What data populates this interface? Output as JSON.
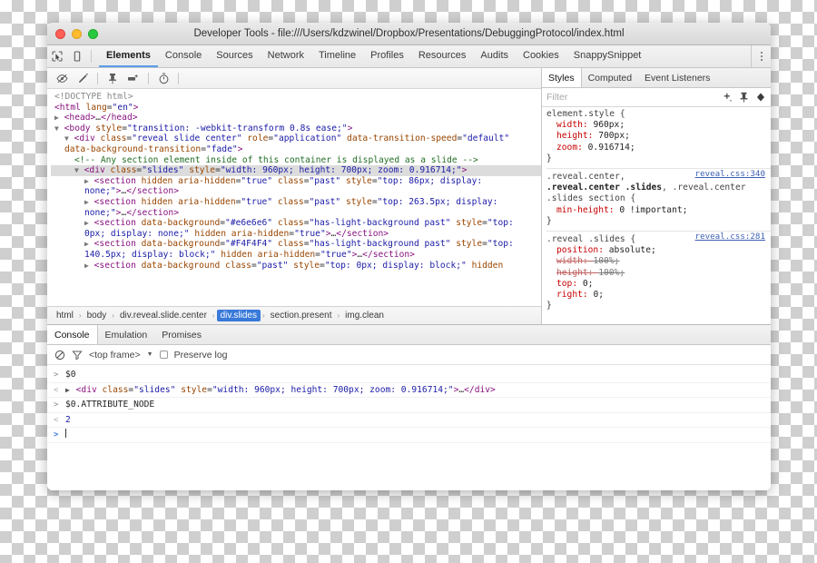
{
  "window": {
    "title": "Developer Tools - file:///Users/kdzwinel/Dropbox/Presentations/DebuggingProtocol/index.html",
    "traffic_lights": [
      "close-red",
      "minimize-yellow",
      "zoom-green"
    ]
  },
  "main_tabs": {
    "inspect_icon": "inspect-element-icon",
    "device_icon": "device-toolbar-icon",
    "menu_icon": "more-options-icon",
    "items": [
      {
        "label": "Elements",
        "active": true
      },
      {
        "label": "Console",
        "active": false
      },
      {
        "label": "Sources",
        "active": false
      },
      {
        "label": "Network",
        "active": false
      },
      {
        "label": "Timeline",
        "active": false
      },
      {
        "label": "Profiles",
        "active": false
      },
      {
        "label": "Resources",
        "active": false
      },
      {
        "label": "Audits",
        "active": false
      },
      {
        "label": "Cookies",
        "active": false
      },
      {
        "label": "SnappySnippet",
        "active": false
      }
    ]
  },
  "elements_toolbar": {
    "icons": [
      "hide-element-icon",
      "edit-as-html-icon",
      "pin-icon",
      "new-style-rule-icon",
      "animation-timer-icon"
    ]
  },
  "dom_tree": {
    "lines": [
      {
        "indent": 0,
        "twisty": "",
        "parts": [
          {
            "c": "dt",
            "t": "<!DOCTYPE html>"
          }
        ]
      },
      {
        "indent": 0,
        "twisty": "",
        "parts": [
          {
            "c": "tag",
            "t": "<html "
          },
          {
            "c": "attr",
            "t": "lang"
          },
          {
            "c": "txt",
            "t": "="
          },
          {
            "c": "val",
            "t": "\"en\""
          },
          {
            "c": "tag",
            "t": ">"
          }
        ]
      },
      {
        "indent": 0,
        "twisty": "right",
        "parts": [
          {
            "c": "tag",
            "t": "<head>"
          },
          {
            "c": "txt",
            "t": "…"
          },
          {
            "c": "tag",
            "t": "</head>"
          }
        ]
      },
      {
        "indent": 0,
        "twisty": "down",
        "parts": [
          {
            "c": "tag",
            "t": "<body "
          },
          {
            "c": "attr",
            "t": "style"
          },
          {
            "c": "txt",
            "t": "="
          },
          {
            "c": "val",
            "t": "\"transition: -webkit-transform 0.8s ease;\""
          },
          {
            "c": "tag",
            "t": ">"
          }
        ]
      },
      {
        "indent": 1,
        "twisty": "down",
        "parts": [
          {
            "c": "tag",
            "t": "<div "
          },
          {
            "c": "attr",
            "t": "class"
          },
          {
            "c": "txt",
            "t": "="
          },
          {
            "c": "val",
            "t": "\"reveal slide center\""
          },
          {
            "c": "txt",
            "t": " "
          },
          {
            "c": "attr",
            "t": "role"
          },
          {
            "c": "txt",
            "t": "="
          },
          {
            "c": "val",
            "t": "\"application\""
          },
          {
            "c": "txt",
            "t": " "
          },
          {
            "c": "attr",
            "t": "data-transition-speed"
          },
          {
            "c": "txt",
            "t": "="
          },
          {
            "c": "val",
            "t": "\"default\""
          }
        ]
      },
      {
        "indent": 1,
        "twisty": "",
        "parts": [
          {
            "c": "attr",
            "t": "data-background-transition"
          },
          {
            "c": "txt",
            "t": "="
          },
          {
            "c": "val",
            "t": "\"fade\""
          },
          {
            "c": "tag",
            "t": ">"
          }
        ]
      },
      {
        "indent": 2,
        "twisty": "",
        "parts": [
          {
            "c": "cmt",
            "t": "<!-- Any section element inside of this container is displayed as a slide -->"
          }
        ]
      },
      {
        "indent": 2,
        "twisty": "down",
        "selected": true,
        "parts": [
          {
            "c": "tag",
            "t": "<div "
          },
          {
            "c": "attr",
            "t": "class"
          },
          {
            "c": "txt",
            "t": "="
          },
          {
            "c": "val",
            "t": "\"slides\""
          },
          {
            "c": "txt",
            "t": " "
          },
          {
            "c": "attr",
            "t": "style"
          },
          {
            "c": "txt",
            "t": "="
          },
          {
            "c": "val",
            "t": "\"width: 960px; height: 700px; zoom: 0.916714;\""
          },
          {
            "c": "tag",
            "t": ">"
          }
        ]
      },
      {
        "indent": 3,
        "twisty": "right",
        "parts": [
          {
            "c": "tag",
            "t": "<section "
          },
          {
            "c": "attr",
            "t": "hidden"
          },
          {
            "c": "txt",
            "t": " "
          },
          {
            "c": "attr",
            "t": "aria-hidden"
          },
          {
            "c": "txt",
            "t": "="
          },
          {
            "c": "val",
            "t": "\"true\""
          },
          {
            "c": "txt",
            "t": " "
          },
          {
            "c": "attr",
            "t": "class"
          },
          {
            "c": "txt",
            "t": "="
          },
          {
            "c": "val",
            "t": "\"past\""
          },
          {
            "c": "txt",
            "t": " "
          },
          {
            "c": "attr",
            "t": "style"
          },
          {
            "c": "txt",
            "t": "="
          },
          {
            "c": "val",
            "t": "\"top: 86px; display:"
          }
        ]
      },
      {
        "indent": 3,
        "twisty": "",
        "parts": [
          {
            "c": "val",
            "t": "none;\""
          },
          {
            "c": "tag",
            "t": ">"
          },
          {
            "c": "txt",
            "t": "…"
          },
          {
            "c": "tag",
            "t": "</section>"
          }
        ]
      },
      {
        "indent": 3,
        "twisty": "right",
        "parts": [
          {
            "c": "tag",
            "t": "<section "
          },
          {
            "c": "attr",
            "t": "hidden"
          },
          {
            "c": "txt",
            "t": " "
          },
          {
            "c": "attr",
            "t": "aria-hidden"
          },
          {
            "c": "txt",
            "t": "="
          },
          {
            "c": "val",
            "t": "\"true\""
          },
          {
            "c": "txt",
            "t": " "
          },
          {
            "c": "attr",
            "t": "class"
          },
          {
            "c": "txt",
            "t": "="
          },
          {
            "c": "val",
            "t": "\"past\""
          },
          {
            "c": "txt",
            "t": " "
          },
          {
            "c": "attr",
            "t": "style"
          },
          {
            "c": "txt",
            "t": "="
          },
          {
            "c": "val",
            "t": "\"top: 263.5px; display:"
          }
        ]
      },
      {
        "indent": 3,
        "twisty": "",
        "parts": [
          {
            "c": "val",
            "t": "none;\""
          },
          {
            "c": "tag",
            "t": ">"
          },
          {
            "c": "txt",
            "t": "…"
          },
          {
            "c": "tag",
            "t": "</section>"
          }
        ]
      },
      {
        "indent": 3,
        "twisty": "right",
        "parts": [
          {
            "c": "tag",
            "t": "<section "
          },
          {
            "c": "attr",
            "t": "data-background"
          },
          {
            "c": "txt",
            "t": "="
          },
          {
            "c": "val",
            "t": "\"#e6e6e6\""
          },
          {
            "c": "txt",
            "t": " "
          },
          {
            "c": "attr",
            "t": "class"
          },
          {
            "c": "txt",
            "t": "="
          },
          {
            "c": "val",
            "t": "\"has-light-background past\""
          },
          {
            "c": "txt",
            "t": " "
          },
          {
            "c": "attr",
            "t": "style"
          },
          {
            "c": "txt",
            "t": "="
          },
          {
            "c": "val",
            "t": "\"top:"
          }
        ]
      },
      {
        "indent": 3,
        "twisty": "",
        "parts": [
          {
            "c": "val",
            "t": "0px; display: none;\""
          },
          {
            "c": "txt",
            "t": " "
          },
          {
            "c": "attr",
            "t": "hidden"
          },
          {
            "c": "txt",
            "t": " "
          },
          {
            "c": "attr",
            "t": "aria-hidden"
          },
          {
            "c": "txt",
            "t": "="
          },
          {
            "c": "val",
            "t": "\"true\""
          },
          {
            "c": "tag",
            "t": ">"
          },
          {
            "c": "txt",
            "t": "…"
          },
          {
            "c": "tag",
            "t": "</section>"
          }
        ]
      },
      {
        "indent": 3,
        "twisty": "right",
        "parts": [
          {
            "c": "tag",
            "t": "<section "
          },
          {
            "c": "attr",
            "t": "data-background"
          },
          {
            "c": "txt",
            "t": "="
          },
          {
            "c": "val",
            "t": "\"#F4F4F4\""
          },
          {
            "c": "txt",
            "t": " "
          },
          {
            "c": "attr",
            "t": "class"
          },
          {
            "c": "txt",
            "t": "="
          },
          {
            "c": "val",
            "t": "\"has-light-background past\""
          },
          {
            "c": "txt",
            "t": " "
          },
          {
            "c": "attr",
            "t": "style"
          },
          {
            "c": "txt",
            "t": "="
          },
          {
            "c": "val",
            "t": "\"top:"
          }
        ]
      },
      {
        "indent": 3,
        "twisty": "",
        "parts": [
          {
            "c": "val",
            "t": "140.5px; display: block;\""
          },
          {
            "c": "txt",
            "t": " "
          },
          {
            "c": "attr",
            "t": "hidden"
          },
          {
            "c": "txt",
            "t": " "
          },
          {
            "c": "attr",
            "t": "aria-hidden"
          },
          {
            "c": "txt",
            "t": "="
          },
          {
            "c": "val",
            "t": "\"true\""
          },
          {
            "c": "tag",
            "t": ">"
          },
          {
            "c": "txt",
            "t": "…"
          },
          {
            "c": "tag",
            "t": "</section>"
          }
        ]
      },
      {
        "indent": 3,
        "twisty": "right",
        "parts": [
          {
            "c": "tag",
            "t": "<section "
          },
          {
            "c": "attr",
            "t": "data-background"
          },
          {
            "c": "txt",
            "t": " "
          },
          {
            "c": "attr",
            "t": "class"
          },
          {
            "c": "txt",
            "t": "="
          },
          {
            "c": "val",
            "t": "\"past\""
          },
          {
            "c": "txt",
            "t": " "
          },
          {
            "c": "attr",
            "t": "style"
          },
          {
            "c": "txt",
            "t": "="
          },
          {
            "c": "val",
            "t": "\"top: 0px; display: block;\""
          },
          {
            "c": "txt",
            "t": " "
          },
          {
            "c": "attr",
            "t": "hidden"
          }
        ]
      }
    ]
  },
  "breadcrumb": {
    "items": [
      {
        "label": "html",
        "active": false
      },
      {
        "label": "body",
        "active": false
      },
      {
        "label": "div.reveal.slide.center",
        "active": false
      },
      {
        "label": "div.slides",
        "active": true
      },
      {
        "label": "section.present",
        "active": false
      },
      {
        "label": "img.clean",
        "active": false
      }
    ],
    "separator": "›"
  },
  "styles_panel": {
    "tabs": [
      {
        "label": "Styles",
        "active": true
      },
      {
        "label": "Computed",
        "active": false
      },
      {
        "label": "Event Listeners",
        "active": false
      }
    ],
    "filter_placeholder": "Filter",
    "toolbar_icons": [
      "new-style-rule-icon",
      "pin-icon",
      "toggle-element-state-icon"
    ],
    "rules": [
      {
        "selector_plain": "element.style {",
        "source": "",
        "declarations": [
          {
            "prop": "width",
            "value": "960px;",
            "overridden": false
          },
          {
            "prop": "height",
            "value": "700px;",
            "overridden": false
          },
          {
            "prop": "zoom",
            "value": "0.916714;",
            "overridden": false
          }
        ]
      },
      {
        "selector_line1": ".reveal.center,",
        "selector_line2_bold": ".reveal.center .slides",
        "selector_line2_rest": ", .reveal.center",
        "selector_line3": ".slides section {",
        "source": "reveal.css:340",
        "declarations": [
          {
            "prop": "min-height",
            "value": "0 !important;",
            "overridden": false
          }
        ]
      },
      {
        "selector_plain": ".reveal .slides {",
        "source": "reveal.css:281",
        "declarations": [
          {
            "prop": "position",
            "value": "absolute;",
            "overridden": false
          },
          {
            "prop": "width",
            "value": "100%;",
            "overridden": true
          },
          {
            "prop": "height",
            "value": "100%;",
            "overridden": true
          },
          {
            "prop": "top",
            "value": "0;",
            "overridden": false
          },
          {
            "prop": "right",
            "value": "0;",
            "overridden": false
          }
        ]
      }
    ]
  },
  "drawer": {
    "tabs": [
      {
        "label": "Console",
        "active": true
      },
      {
        "label": "Emulation",
        "active": false
      },
      {
        "label": "Promises",
        "active": false
      }
    ],
    "toolbar": {
      "clear_icon": "clear-console-icon",
      "filter_icon": "filter-icon",
      "context": "<top frame>",
      "context_caret": "▼",
      "preserve_log_label": "Preserve log",
      "preserve_log_checked": false
    },
    "log": [
      {
        "mark": ">",
        "kind": "input",
        "text": "$0"
      },
      {
        "mark": "<",
        "kind": "output",
        "expandable": true,
        "parts": [
          {
            "c": "tag",
            "t": "<div "
          },
          {
            "c": "attr",
            "t": "class"
          },
          {
            "c": "txt",
            "t": "="
          },
          {
            "c": "val",
            "t": "\"slides\""
          },
          {
            "c": "txt",
            "t": " "
          },
          {
            "c": "attr",
            "t": "style"
          },
          {
            "c": "txt",
            "t": "="
          },
          {
            "c": "val",
            "t": "\"width: 960px; height: 700px; zoom: 0.916714;\""
          },
          {
            "c": "tag",
            "t": ">"
          },
          {
            "c": "txt",
            "t": "…"
          },
          {
            "c": "tag",
            "t": "</div>"
          }
        ]
      },
      {
        "mark": ">",
        "kind": "input",
        "text": "$0.ATTRIBUTE_NODE"
      },
      {
        "mark": "<",
        "kind": "output",
        "number": "2"
      },
      {
        "mark": ">",
        "kind": "prompt",
        "text": ""
      }
    ]
  },
  "colors": {
    "accent_blue": "#3879d9",
    "tab_underline": "#5a9ded",
    "selection_gray": "#dcdcdc",
    "tag_purple": "#881280",
    "attr_orange": "#994500",
    "value_blue": "#1a1aa6",
    "comment_green": "#236e25",
    "property_red": "#c80000"
  }
}
